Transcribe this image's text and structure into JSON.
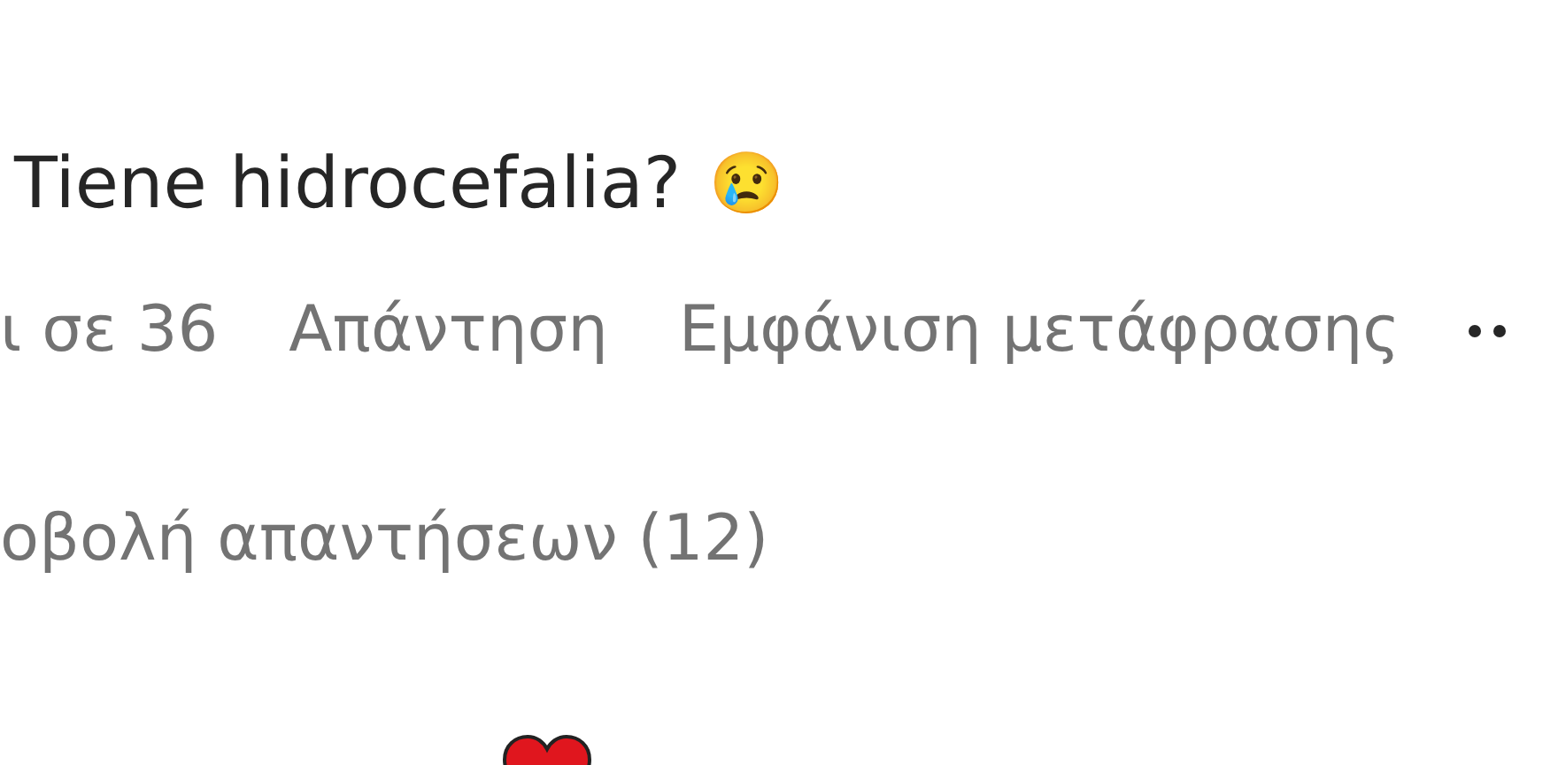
{
  "comment": {
    "text": "Tiene hidrocefalia?",
    "emoji": "😢"
  },
  "actions": [
    {
      "label": "ι σε 36"
    },
    {
      "label": "Απάντηση"
    },
    {
      "label": "Εμφάνιση μετάφρασης"
    }
  ],
  "replies": {
    "label": "οβολή απαντήσεων (12)"
  }
}
